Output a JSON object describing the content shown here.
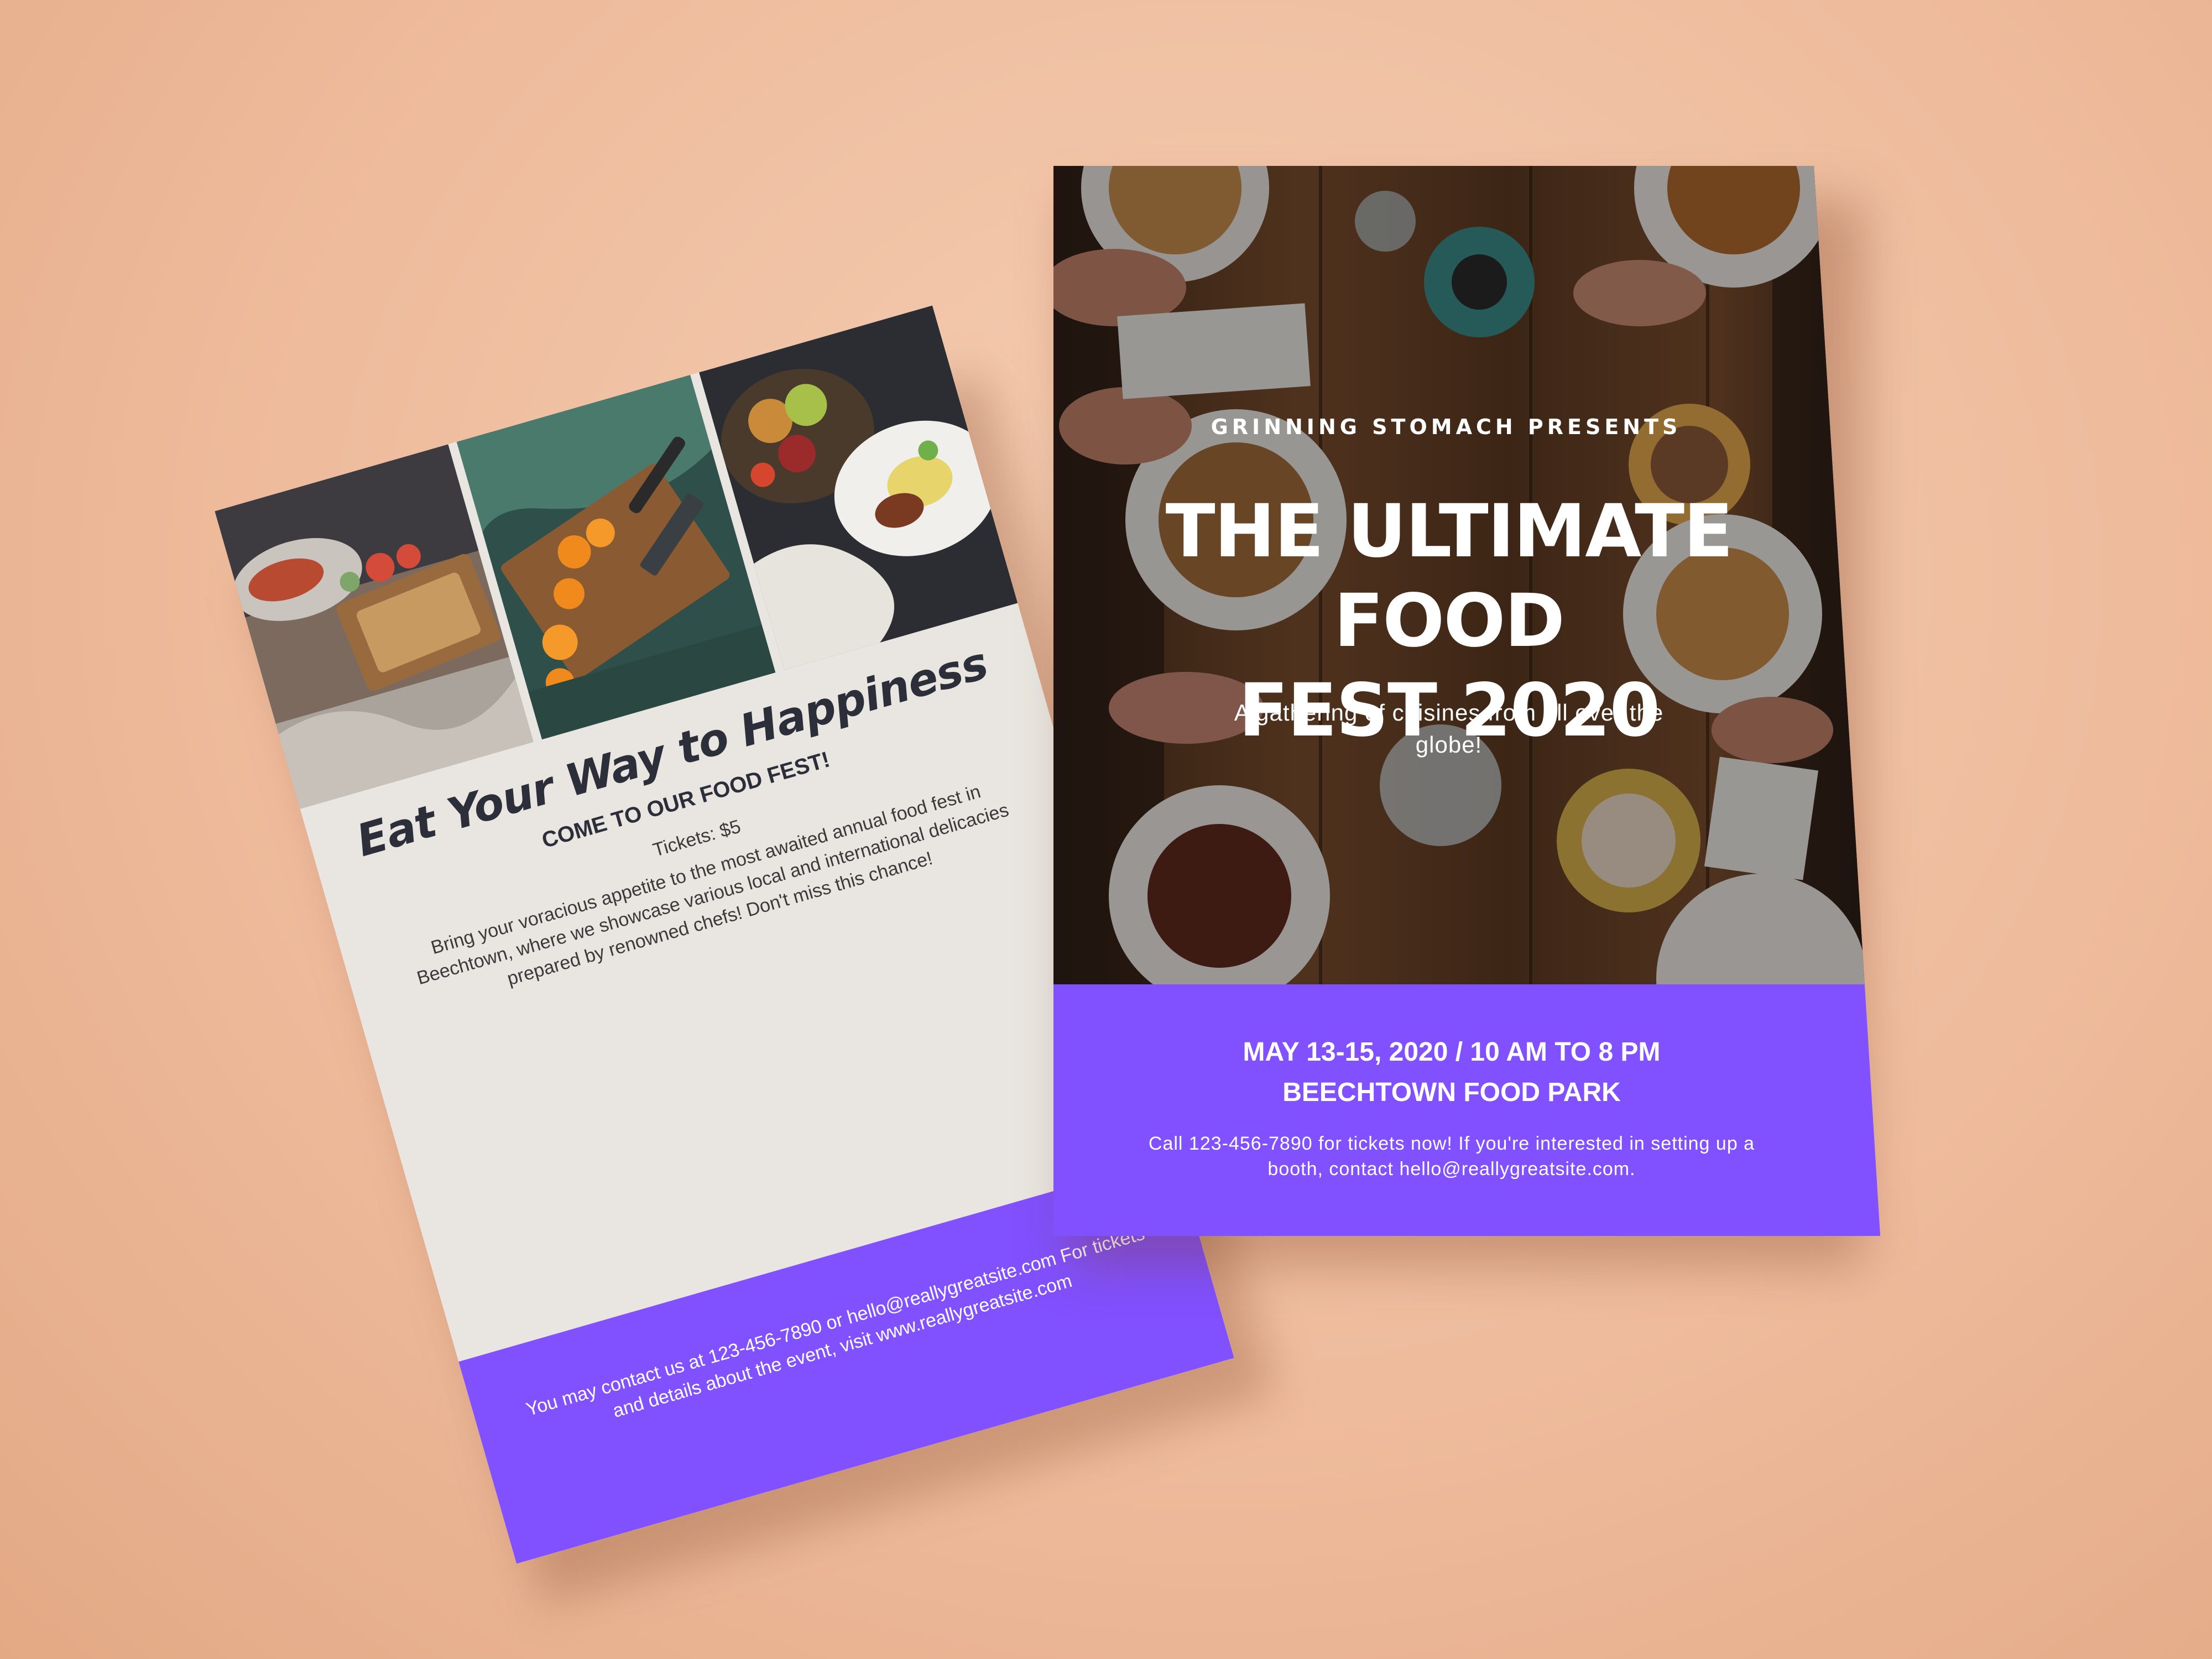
{
  "back_flyer": {
    "title": "Eat Your Way to Happiness",
    "subtitle": "COME TO OUR FOOD FEST!",
    "tickets": "Tickets: $5",
    "body": "Bring your voracious appetite to the most awaited annual food fest in Beechtown, where we showcase various local and international delicacies prepared by renowned chefs! Don't miss this chance!",
    "footer_text": "You may contact us at 123-456-7890 or hello@reallygreatsite.com For tickets and details about the event, visit www.reallygreatsite.com",
    "photos": [
      "sandwich-photo",
      "cutting-board-photo",
      "fruit-platter-photo"
    ]
  },
  "front_flyer": {
    "presenter": "GRINNING STOMACH PRESENTS",
    "title_line1": "THE ULTIMATE FOOD",
    "title_line2": "FEST 2020",
    "tagline": "A gathering of cuisines from all over the globe!",
    "date_time": "MAY 13-15, 2020 / 10 AM TO 8 PM",
    "venue": "BEECHTOWN FOOD PARK",
    "contact": "Call 123-456-7890 for tickets now! If you're interested in setting up a booth, contact hello@reallygreatsite.com.",
    "photo": "dining-table-photo"
  },
  "colors": {
    "background": "#eebb9c",
    "accent_purple": "#8150ff",
    "paper": "#e9e6e1",
    "dark_text": "#2c2f3a"
  }
}
